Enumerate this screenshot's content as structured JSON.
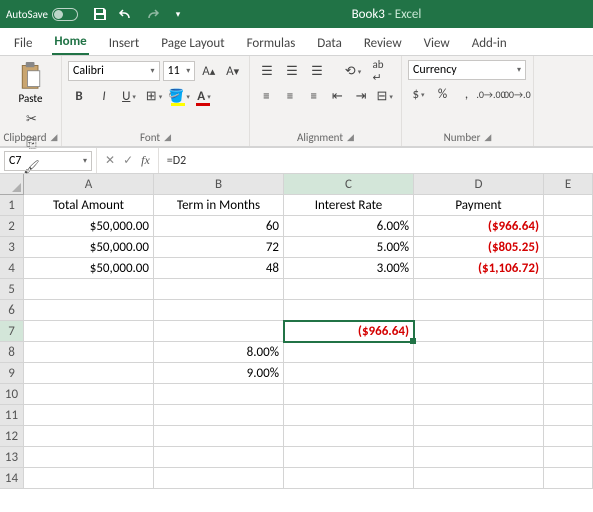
{
  "titlebar": {
    "autosave": "AutoSave",
    "toggle": "Off",
    "book": "Book3",
    "app": "Excel"
  },
  "tabs": [
    "File",
    "Home",
    "Insert",
    "Page Layout",
    "Formulas",
    "Data",
    "Review",
    "View",
    "Add-in"
  ],
  "active_tab": 1,
  "ribbon": {
    "clipboard": {
      "paste": "Paste",
      "label": "Clipboard"
    },
    "font": {
      "name": "Calibri",
      "size": "11",
      "label": "Font"
    },
    "alignment": {
      "label": "Alignment"
    },
    "number": {
      "format": "Currency",
      "label": "Number"
    }
  },
  "namebox": "C7",
  "formula": "=D2",
  "columns": [
    "A",
    "B",
    "C",
    "D",
    "E"
  ],
  "rownums": [
    "1",
    "2",
    "3",
    "4",
    "5",
    "6",
    "7",
    "8",
    "9",
    "10",
    "11",
    "12",
    "13",
    "14"
  ],
  "sheet": {
    "h": [
      "Total Amount",
      "Term in Months",
      "Interest Rate",
      "Payment"
    ],
    "r2": [
      "$50,000.00",
      "60",
      "6.00%",
      "($966.64)"
    ],
    "r3": [
      "$50,000.00",
      "72",
      "5.00%",
      "($805.25)"
    ],
    "r4": [
      "$50,000.00",
      "48",
      "3.00%",
      "($1,106.72)"
    ],
    "c7": "($966.64)",
    "b8": "8.00%",
    "b9": "9.00%"
  },
  "chart_data": {
    "type": "table",
    "columns": [
      "Total Amount",
      "Term in Months",
      "Interest Rate",
      "Payment"
    ],
    "rows": [
      [
        50000.0,
        60,
        0.06,
        -966.64
      ],
      [
        50000.0,
        72,
        0.05,
        -805.25
      ],
      [
        50000.0,
        48,
        0.03,
        -1106.72
      ]
    ],
    "extra_cells": {
      "C7": -966.64,
      "B8": 0.08,
      "B9": 0.09
    }
  }
}
